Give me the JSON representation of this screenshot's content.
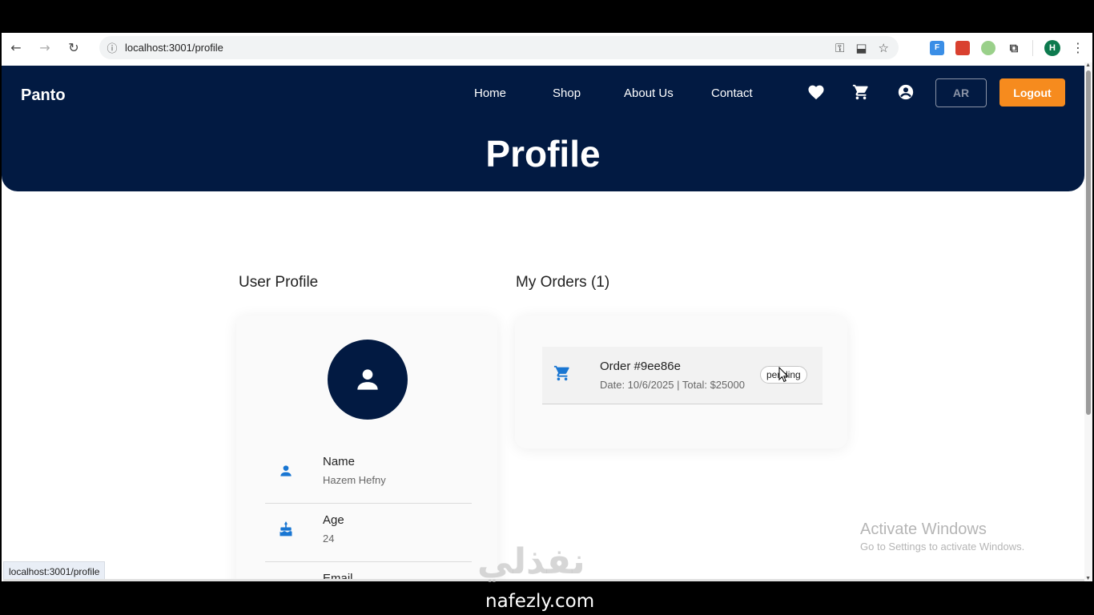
{
  "browser": {
    "url": "localhost:3001/profile",
    "profile_initial": "H",
    "extensions": [
      "F",
      "pdf",
      "",
      "puzzle-icon"
    ]
  },
  "header": {
    "brand": "Panto",
    "menu": [
      "Home",
      "Shop",
      "About Us",
      "Contact"
    ],
    "lang_button": "AR",
    "logout_button": "Logout",
    "page_title": "Profile"
  },
  "profile": {
    "section_title": "User Profile",
    "fields": [
      {
        "label": "Name",
        "value": "Hazem Hefny",
        "icon": "person-icon"
      },
      {
        "label": "Age",
        "value": "24",
        "icon": "cake-icon"
      },
      {
        "label": "Email",
        "value": "",
        "icon": "email-icon"
      }
    ]
  },
  "orders": {
    "section_title": "My Orders (1)",
    "items": [
      {
        "title": "Order #9ee86e",
        "meta": "Date: 10/6/2025 | Total: $25000",
        "status": "pending"
      }
    ]
  },
  "status_bar_url": "localhost:3001/profile",
  "windows_watermark": {
    "line1": "Activate Windows",
    "line2": "Go to Settings to activate Windows."
  },
  "overlay": {
    "arabic_logo": "نفذلي",
    "site": "nafezly.com"
  },
  "colors": {
    "navy": "#021a42",
    "accent": "#f68b1e",
    "icon_blue": "#1976d2"
  }
}
